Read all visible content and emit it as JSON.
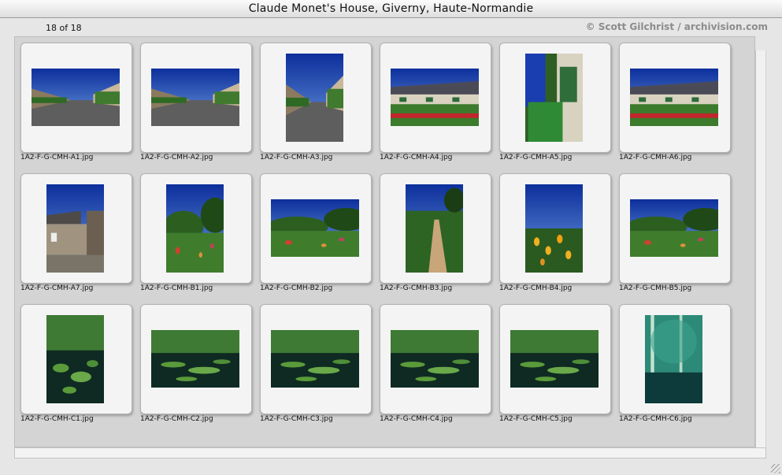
{
  "window": {
    "title": "Claude Monet's House, Giverny, Haute-Normandie"
  },
  "header": {
    "count": "18 of 18",
    "copyright": "© Scott Gilchrist / archivision.com"
  },
  "thumbnails": [
    {
      "filename": "1A2-F-G-CMH-A1.jpg",
      "orientation": "landscape",
      "scene": "street"
    },
    {
      "filename": "1A2-F-G-CMH-A2.jpg",
      "orientation": "landscape",
      "scene": "street"
    },
    {
      "filename": "1A2-F-G-CMH-A3.jpg",
      "orientation": "portrait",
      "scene": "street"
    },
    {
      "filename": "1A2-F-G-CMH-A4.jpg",
      "orientation": "landscape",
      "scene": "house"
    },
    {
      "filename": "1A2-F-G-CMH-A5.jpg",
      "orientation": "portrait",
      "scene": "porch"
    },
    {
      "filename": "1A2-F-G-CMH-A6.jpg",
      "orientation": "landscape",
      "scene": "house"
    },
    {
      "filename": "1A2-F-G-CMH-A7.jpg",
      "orientation": "portrait",
      "scene": "stonehouse"
    },
    {
      "filename": "1A2-F-G-CMH-B1.jpg",
      "orientation": "portrait",
      "scene": "garden"
    },
    {
      "filename": "1A2-F-G-CMH-B2.jpg",
      "orientation": "landscape",
      "scene": "garden"
    },
    {
      "filename": "1A2-F-G-CMH-B3.jpg",
      "orientation": "portrait",
      "scene": "path"
    },
    {
      "filename": "1A2-F-G-CMH-B4.jpg",
      "orientation": "portrait",
      "scene": "flowers"
    },
    {
      "filename": "1A2-F-G-CMH-B5.jpg",
      "orientation": "landscape",
      "scene": "garden"
    },
    {
      "filename": "1A2-F-G-CMH-C1.jpg",
      "orientation": "portrait",
      "scene": "pond"
    },
    {
      "filename": "1A2-F-G-CMH-C2.jpg",
      "orientation": "landscape",
      "scene": "pond"
    },
    {
      "filename": "1A2-F-G-CMH-C3.jpg",
      "orientation": "landscape",
      "scene": "pond"
    },
    {
      "filename": "1A2-F-G-CMH-C4.jpg",
      "orientation": "landscape",
      "scene": "pond"
    },
    {
      "filename": "1A2-F-G-CMH-C5.jpg",
      "orientation": "landscape",
      "scene": "pond"
    },
    {
      "filename": "1A2-F-G-CMH-C6.jpg",
      "orientation": "portrait",
      "scene": "teal"
    }
  ]
}
